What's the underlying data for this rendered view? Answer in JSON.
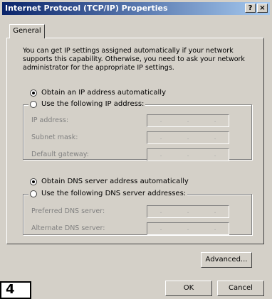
{
  "window": {
    "title": "Internet Protocol (TCP/IP) Properties",
    "help_label": "?",
    "close_label": "×"
  },
  "tabs": [
    {
      "label": "General"
    }
  ],
  "intro_text": "You can get IP settings assigned automatically if your network supports this capability. Otherwise, you need to ask your network administrator for the appropriate IP settings.",
  "ip": {
    "auto_label": "Obtain an IP address automatically",
    "manual_label": "Use the following IP address:",
    "selected": "auto",
    "fields": [
      {
        "label": "IP address:",
        "value": ""
      },
      {
        "label": "Subnet mask:",
        "value": ""
      },
      {
        "label": "Default gateway:",
        "value": ""
      }
    ]
  },
  "dns": {
    "auto_label": "Obtain DNS server address automatically",
    "manual_label": "Use the following DNS server addresses:",
    "selected": "auto",
    "fields": [
      {
        "label": "Preferred DNS server:",
        "value": ""
      },
      {
        "label": "Alternate DNS server:",
        "value": ""
      }
    ]
  },
  "buttons": {
    "advanced": "Advanced...",
    "ok": "OK",
    "cancel": "Cancel"
  },
  "corner_label": "4",
  "colors": {
    "title_start": "#0a246a",
    "title_end": "#a6caf0",
    "face": "#d4d0c8",
    "disabled_text": "#808080"
  }
}
